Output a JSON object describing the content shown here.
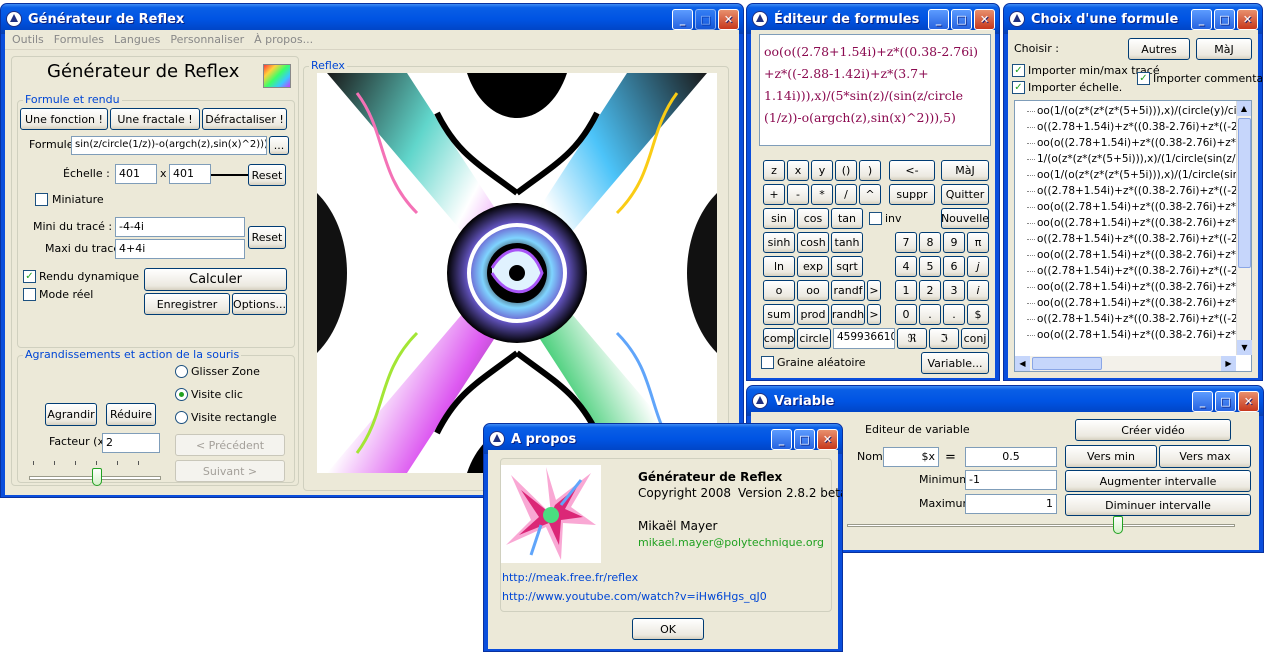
{
  "main_window": {
    "title": "Générateur de Reflex",
    "menu": [
      "Outils",
      "Formules",
      "Langues",
      "Personnaliser",
      "À propos..."
    ],
    "app_heading": "Générateur de Reflex",
    "group_formula": "Formule et rendu",
    "btn_function": "Une fonction !",
    "btn_fractal": "Une fractale !",
    "btn_defract": "Défractaliser !",
    "formula_label": "Formule :",
    "formula_value": "sin(z/circle(1/z))-o(argch(z),sin(x)^2))),5)",
    "formula_more": "...",
    "scale_label": "Échelle :",
    "scale_w": "401",
    "scale_x": "x",
    "scale_h": "401",
    "reset1": "Reset",
    "miniature": "Miniature",
    "mini_label": "Mini du tracé :",
    "mini_value": "-4-4i",
    "maxi_label": "Maxi du tracé :",
    "maxi_value": "4+4i",
    "reset2": "Reset",
    "rendu_dyn": "Rendu dynamique",
    "mode_reel": "Mode réel",
    "calculer": "Calculer",
    "enregistrer": "Enregistrer",
    "options": "Options...",
    "group_zoom": "Agrandissements et action de la souris",
    "glisser": "Glisser Zone",
    "visite_clic": "Visite clic",
    "visite_rect": "Visite rectangle",
    "agrandir": "Agrandir",
    "reduire": "Réduire",
    "facteur_label": "Facteur (x)",
    "facteur_value": "2",
    "precedent": "< Précédent",
    "suivant": "Suivant >",
    "reflex_label": "Reflex"
  },
  "editor_window": {
    "title": "Éditeur de formules",
    "formula_lines": [
      "oo(o((2.78+1.54i)+z*((0.38-2.76i)",
      "+z*((-2.88-1.42i)+z*(3.7+",
      "1.14i))),x)/(5*sin(z)/(sin(z/circle",
      "(1/z))-o(argch(z),sin(x)^2))),5)"
    ],
    "rows": [
      [
        "z",
        "x",
        "y",
        "()",
        ")",
        "<-",
        "MàJ"
      ],
      [
        "+",
        "-",
        "*",
        "/",
        "^",
        "suppr",
        "Quitter"
      ],
      [
        "sin",
        "cos",
        "tan",
        "inv",
        "Nouvelle"
      ],
      [
        "sinh",
        "cosh",
        "tanh",
        "7",
        "8",
        "9",
        "π"
      ],
      [
        "ln",
        "exp",
        "sqrt",
        "4",
        "5",
        "6",
        "j"
      ],
      [
        "o",
        "oo",
        "randf",
        ">",
        "1",
        "2",
        "3",
        "i"
      ],
      [
        "sum",
        "prod",
        "randh",
        ">",
        "0",
        ".",
        ".",
        "$"
      ],
      [
        "comp",
        "circle",
        "459936610",
        "ℜ",
        "ℑ",
        "conj"
      ]
    ],
    "graine": "Graine aléatoire",
    "variable_btn": "Variable..."
  },
  "choice_window": {
    "title": "Choix d'une formule",
    "choisir": "Choisir :",
    "autres": "Autres",
    "maj": "MàJ",
    "import_minmax": "Importer min/max tracé",
    "import_comment": "Importer commentaire",
    "import_echelle": "Importer échelle.",
    "items": [
      "oo(1/(o(z*(z*(z*(5+5i))),x)/(circle(y)/circle(",
      "o((2.78+1.54i)+z*((0.38-2.76i)+z*((-2.8",
      "oo(o((2.78+1.54i)+z*((0.38-2.76i)+z*((-",
      "1/(o(z*(z*(z*(5+5i))),x)/(1/circle(sin(z/cir",
      "oo(1/(o(z*(z*(z*(5+5i))),x)/(1/circle(sin(z",
      "o((2.78+1.54i)+z*((0.38-2.76i)+z*((-2.8",
      "oo(o((2.78+1.54i)+z*((0.38-2.76i)+z*((-",
      "oo(o((2.78+1.54i)+z*((0.38-2.76i)+z*((-",
      "o((2.78+1.54i)+z*((0.38-2.76i)+z*((-2.8",
      "oo(o((2.78+1.54i)+z*((0.38-2.76i)+z*((-",
      "o((2.78+1.54i)+z*((0.38-2.76i)+z*((-2.8",
      "oo(o((2.78+1.54i)+z*((0.38-2.76i)+z*((-",
      "oo(o((2.78+1.54i)+z*((0.38-2.76i)+z*((-",
      "o((2.78+1.54i)+z*((0.38-2.76i)+z*((-2.8",
      "oo(o((2.78+1.54i)+z*((0.38-2.76i)+z*((-"
    ]
  },
  "variable_window": {
    "title": "Variable",
    "editeur": "Editeur de variable",
    "creer_video": "Créer vidéo",
    "nom_label": "Nom",
    "nom_value": "$x",
    "equals": "=",
    "value": "0.5",
    "vers_min": "Vers min",
    "vers_max": "Vers max",
    "minimum_label": "Minimum",
    "minimum_value": "-1",
    "aug": "Augmenter intervalle",
    "maximum_label": "Maximum",
    "maximum_value": "1",
    "dim": "Diminuer intervalle",
    "slider_position": 0.75
  },
  "about_window": {
    "title": "A propos",
    "app_name": "Générateur de Reflex",
    "copyright": "Copyright 2008",
    "version": "Version 2.8.2 beta",
    "author": "Mikaël Mayer",
    "email": "mikael.mayer@polytechnique.org",
    "link1": "http://meak.free.fr/reflex",
    "link2": "http://www.youtube.com/watch?v=iHw6Hgs_qJ0",
    "ok": "OK"
  },
  "colors": {
    "title_blue": "#0054e3",
    "client": "#ece9d8",
    "group_title": "#0046d5",
    "link": "#0046d5",
    "email": "#21a121",
    "formula_text": "#8b0a50",
    "formula_blue": "#1a1aa0"
  }
}
